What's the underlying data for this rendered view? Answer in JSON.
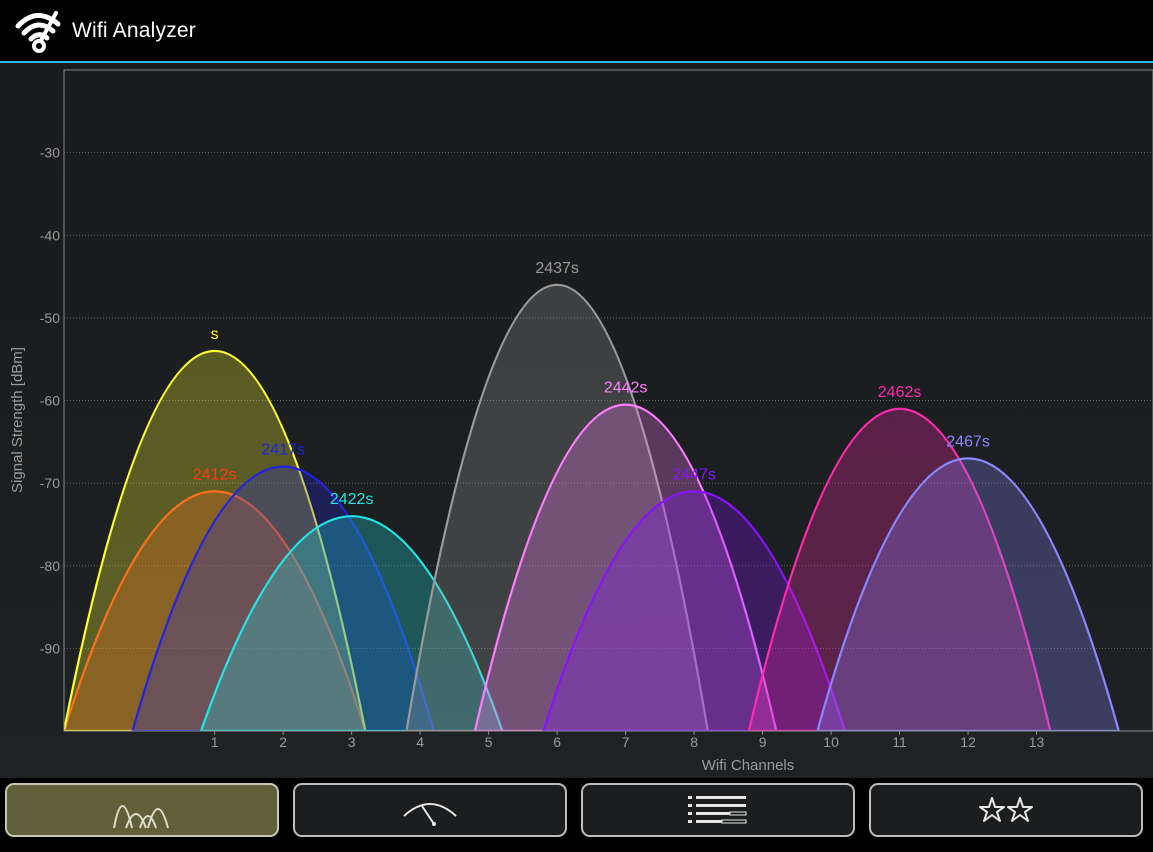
{
  "app": {
    "title": "Wifi Analyzer"
  },
  "colors": {
    "accent": "#33b5e5",
    "active_button": "#5f5f3a"
  },
  "icons": {
    "app": "wifi-signal-icon",
    "tabs": [
      "channel-graph-icon",
      "signal-meter-icon",
      "ap-list-icon",
      "channel-rating-icon"
    ]
  },
  "chart_data": {
    "type": "area",
    "xlabel": "Wifi Channels",
    "ylabel": "Signal Strength [dBm]",
    "xlim": [
      -1.2,
      14.7
    ],
    "ylim": [
      -100,
      -20
    ],
    "x_ticks": [
      1,
      2,
      3,
      4,
      5,
      6,
      7,
      8,
      9,
      10,
      11,
      12,
      13
    ],
    "y_ticks": [
      -30,
      -40,
      -50,
      -60,
      -70,
      -80,
      -90
    ],
    "grid": true,
    "series": [
      {
        "name": "2412s",
        "channel": 1,
        "peak_dbm": -71,
        "half_width": 2.2,
        "color": "#ff3a14"
      },
      {
        "name": "s",
        "channel": 1,
        "peak_dbm": -54,
        "half_width": 2.2,
        "color": "#ffff33"
      },
      {
        "name": "2417s",
        "channel": 2,
        "peak_dbm": -68,
        "half_width": 2.2,
        "color": "#1f24e0"
      },
      {
        "name": "2422s",
        "channel": 3,
        "peak_dbm": -74,
        "half_width": 2.2,
        "color": "#22e6e6"
      },
      {
        "name": "2437s",
        "channel": 6,
        "peak_dbm": -46,
        "half_width": 2.2,
        "color": "#9a9a9a"
      },
      {
        "name": "2442s",
        "channel": 7,
        "peak_dbm": -60.5,
        "half_width": 2.2,
        "color": "#ff7dff"
      },
      {
        "name": "2447s",
        "channel": 8,
        "peak_dbm": -71,
        "half_width": 2.2,
        "color": "#8a12ff"
      },
      {
        "name": "2462s",
        "channel": 11,
        "peak_dbm": -61,
        "half_width": 2.2,
        "color": "#ff2ab0"
      },
      {
        "name": "2467s",
        "channel": 12,
        "peak_dbm": -67,
        "half_width": 2.2,
        "color": "#8888ff"
      }
    ]
  }
}
